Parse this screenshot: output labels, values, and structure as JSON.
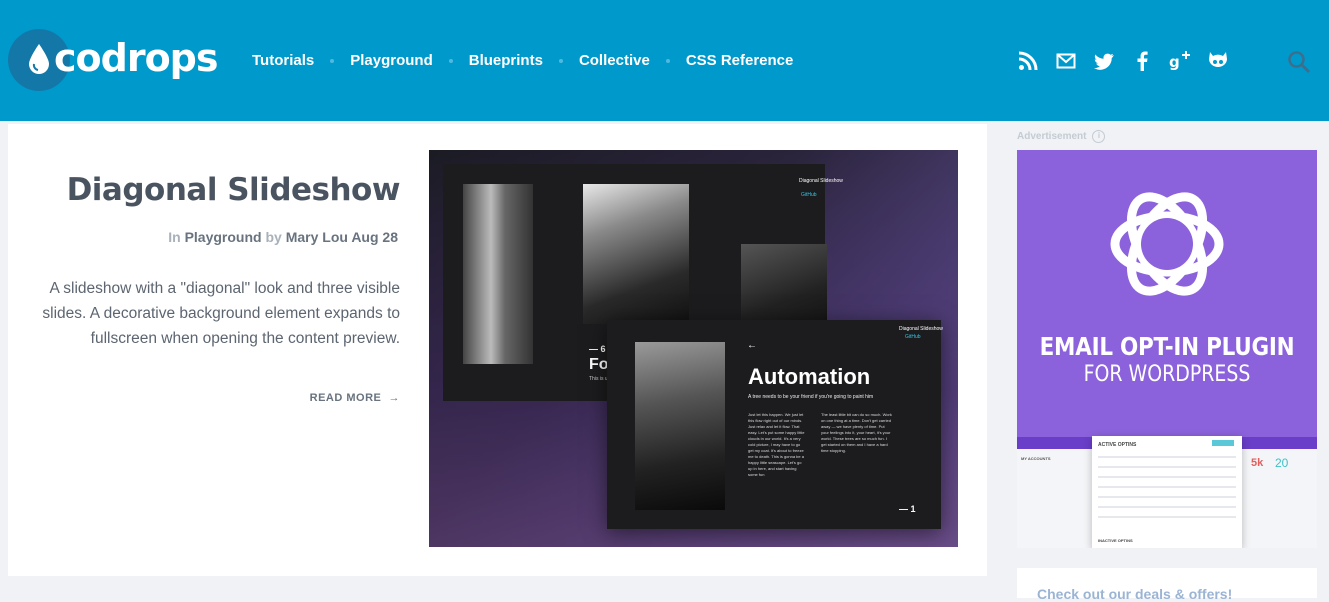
{
  "header": {
    "logo_text": "codrops",
    "nav": [
      "Tutorials",
      "Playground",
      "Blueprints",
      "Collective",
      "CSS Reference"
    ],
    "social_icons": [
      "rss-icon",
      "mail-icon",
      "twitter-icon",
      "facebook-icon",
      "google-plus-icon",
      "github-icon"
    ],
    "search_icon": "search-icon"
  },
  "article": {
    "title": "Diagonal Slideshow",
    "meta_prefix": "In",
    "category": "Playground",
    "meta_by": "by",
    "author": "Mary Lou",
    "date": "Aug 28",
    "excerpt": "A slideshow with a \"diagonal\" look and three visible slides. A decorative background element expands to fullscreen when opening the content preview.",
    "read_more": "READ MORE"
  },
  "hero": {
    "slide_a_caption": "Diagonal Slideshow",
    "slide_a_github": "GitHub",
    "slide_a_number": "— 6",
    "slide_a_title": "Focu",
    "slide_a_sub": "This is unpleasan",
    "slide_b_caption": "Diagonal Slideshow",
    "slide_b_github": "GitHub",
    "slide_b_heading": "Automation",
    "slide_b_sub": "A tree needs to be your friend if you're going to paint him",
    "slide_b_body1": "Just let this happen. We just let this flow right out of our minds. Just relax and let it flow. That easy. Let's put some happy little clouds in our world. It's a very cold picture, I may have to go get my coat. It's about to freeze me to death. This is gonna be a happy little seascape. Let's go up in here, and start having some fun",
    "slide_b_body2": "The least little bit can do so much. Work on one thing at a time. Don't get carried away — we have plenty of time. Put your feelings into it, your heart, it's your world. These trees are so much fun. I get started on them and I have a hard time stopping.",
    "slide_b_number": "— 1"
  },
  "sidebar": {
    "ad_label": "Advertisement",
    "ad_line1": "EMAIL OPT-IN PLUGIN",
    "ad_line2": "FOR WORDPRESS",
    "panel_title": "ACTIVE OPTINS",
    "panel_inactive": "INACTIVE OPTINS",
    "side_label": "MY ACCOUNTS",
    "stat1": "5k",
    "stat2": "20",
    "deals": "Check out our deals & offers!"
  },
  "colors": {
    "header_bg": "#0099cc",
    "ad_bg": "#8b62dc",
    "accent_cyan": "#3cc2e0"
  }
}
